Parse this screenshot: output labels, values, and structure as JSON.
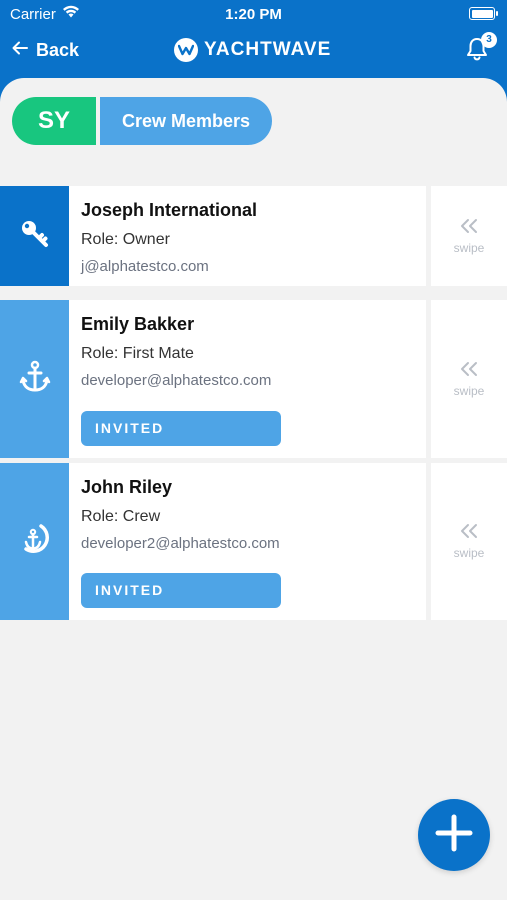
{
  "status_bar": {
    "carrier": "Carrier",
    "time": "1:20 PM"
  },
  "nav": {
    "back_label": "Back",
    "logo_text": "YACHTWAVE",
    "notification_count": "3"
  },
  "chips": {
    "yacht_code": "SY",
    "section_label": "Crew Members"
  },
  "crew": [
    {
      "name": "Joseph International",
      "role": "Role: Owner",
      "email": "j@alphatestco.com",
      "icon": "key-icon",
      "swipe": "swipe"
    },
    {
      "name": "Emily Bakker",
      "role": "Role: First Mate",
      "email": "developer@alphatestco.com",
      "status": "INVITED",
      "icon": "anchor-icon",
      "swipe": "swipe"
    },
    {
      "name": "John Riley",
      "role": "Role: Crew",
      "email": "developer2@alphatestco.com",
      "status": "INVITED",
      "icon": "anchor-circle-icon",
      "swipe": "swipe"
    }
  ],
  "colors": {
    "primary": "#0a72c9",
    "light_blue": "#4ea4e6",
    "green": "#18c67f",
    "background": "#f2f2f2"
  },
  "fab": {
    "icon": "plus-icon"
  }
}
